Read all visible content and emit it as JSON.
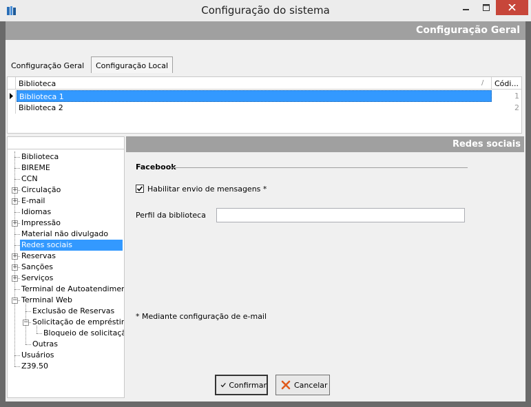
{
  "window": {
    "title": "Configuração do sistema"
  },
  "header": {
    "title": "Configuração Geral"
  },
  "tabs": [
    {
      "label": "Configuração Geral",
      "active": false
    },
    {
      "label": "Configuração Local",
      "active": true
    }
  ],
  "grid": {
    "columns": [
      "Biblioteca",
      "Códi..."
    ],
    "rows": [
      {
        "name": "Biblioteca 1",
        "code": "1",
        "selected": true
      },
      {
        "name": "Biblioteca 2",
        "code": "2",
        "selected": false
      }
    ]
  },
  "tree": {
    "items": [
      "Biblioteca",
      "BIREME",
      "CCN",
      "Circulação",
      "E-mail",
      "Idiomas",
      "Impressão",
      "Material não divulgado",
      "Redes sociais",
      "Reservas",
      "Sanções",
      "Serviços",
      "Terminal de Autoatendiment",
      "Terminal Web",
      "Exclusão de Reservas",
      "Solicitação de empréstimo",
      "Bloqueio de solicitaçã",
      "Outras",
      "Usuários",
      "Z39.50"
    ],
    "selected": "Redes sociais"
  },
  "panel": {
    "title": "Redes sociais",
    "group": "Facebook",
    "checkbox_label": "Habilitar envio de mensagens *",
    "checkbox_checked": true,
    "field_label": "Perfil da biblioteca",
    "field_value": "",
    "footnote": "* Mediante configuração de e-mail"
  },
  "buttons": {
    "confirm": "Confirmar",
    "cancel": "Cancelar"
  },
  "colors": {
    "selection": "#3399ff",
    "band": "#a0a0a0",
    "close": "#c7463a"
  },
  "icons": {
    "app": "books-icon",
    "confirm": "checkmark-icon",
    "cancel": "x-mark-icon"
  }
}
